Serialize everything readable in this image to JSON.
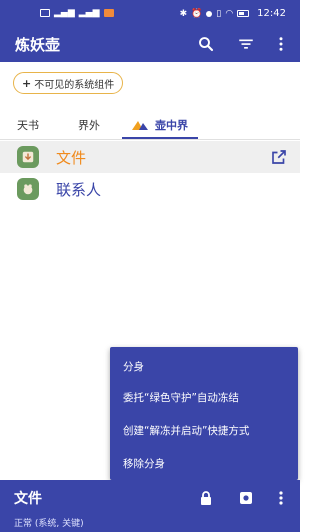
{
  "status_bar": {
    "time": "12:42"
  },
  "app": {
    "title": "炼妖壶"
  },
  "toolbar": {
    "search_icon": "search-icon",
    "filter_icon": "filter-icon",
    "more_icon": "more-vert-icon"
  },
  "chip": {
    "label": "不可见的系统组件"
  },
  "tabs": [
    {
      "label": "天书"
    },
    {
      "label": "界外"
    },
    {
      "label": "壶中界"
    }
  ],
  "list": [
    {
      "label": "文件",
      "color": "#f08a1c"
    },
    {
      "label": "联系人",
      "color": "#3a45a8"
    }
  ],
  "menu": {
    "items": [
      {
        "label": "分身"
      },
      {
        "label": "委托“绿色守护”自动冻结"
      },
      {
        "label": "创建“解冻并启动”快捷方式"
      },
      {
        "label": "移除分身"
      }
    ]
  },
  "bottom": {
    "title": "文件",
    "subtitle": "正常 (系统, 关键)"
  },
  "colors": {
    "primary": "#3a45a8",
    "accent": "#f08a1c",
    "chip_border": "#e8b44a"
  }
}
